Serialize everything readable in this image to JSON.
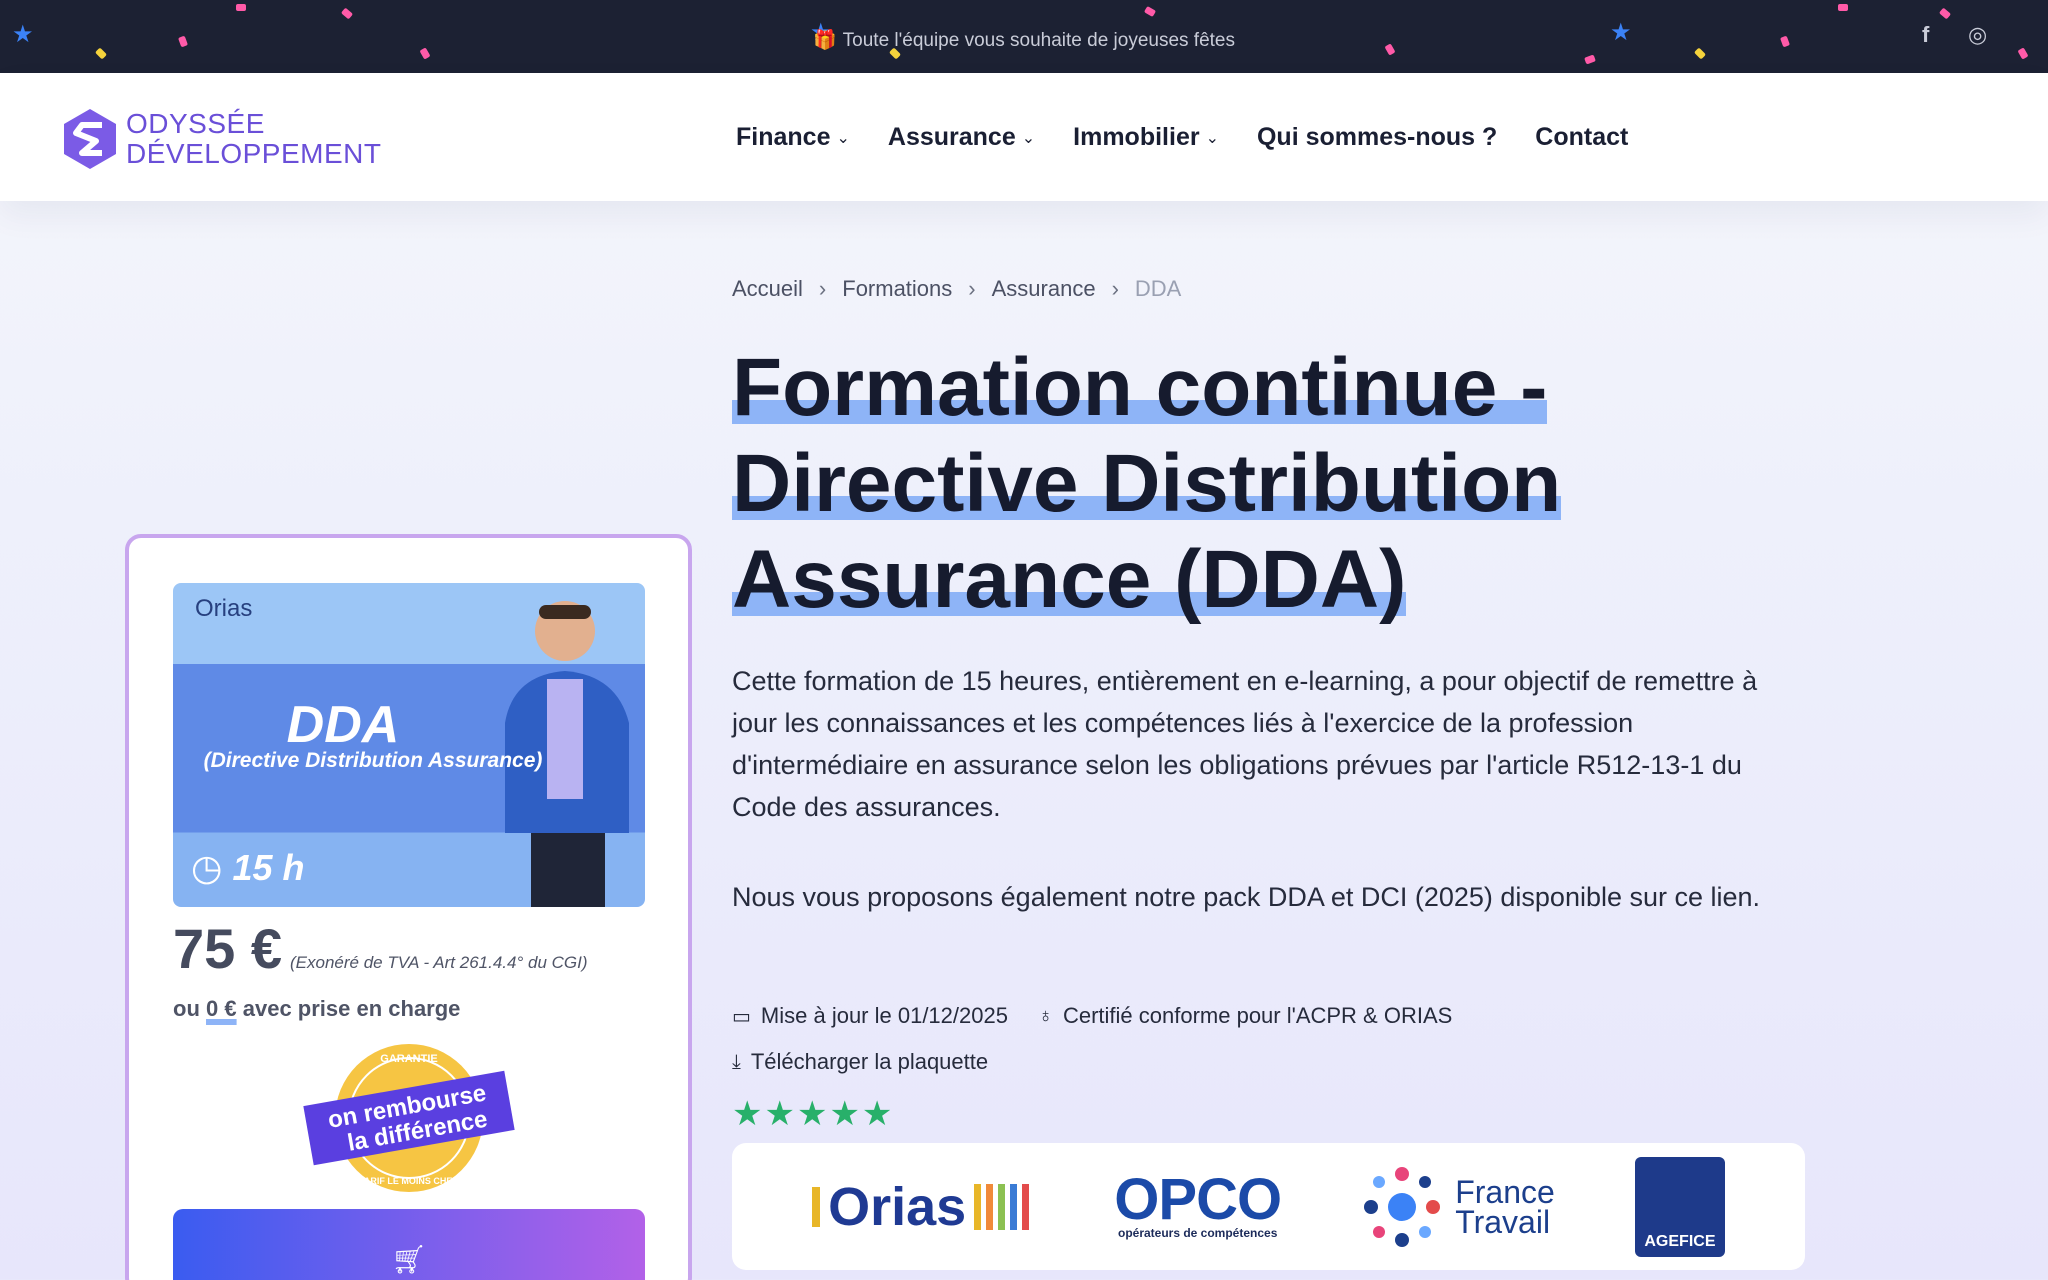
{
  "topbar": {
    "message": "Toute l'équipe vous souhaite de joyeuses fêtes",
    "social": {
      "facebook": "f",
      "instagram": "◎"
    }
  },
  "logo": {
    "line1": "ODYSSÉE",
    "line2": "DÉVELOPPEMENT"
  },
  "nav": {
    "items": [
      {
        "label": "Finance",
        "has_dropdown": true
      },
      {
        "label": "Assurance",
        "has_dropdown": true
      },
      {
        "label": "Immobilier",
        "has_dropdown": true
      },
      {
        "label": "Qui sommes-nous ?",
        "has_dropdown": false
      },
      {
        "label": "Contact",
        "has_dropdown": false
      }
    ]
  },
  "breadcrumb": [
    "Accueil",
    "Formations",
    "Assurance",
    "DDA"
  ],
  "title": {
    "line1": "Formation continue -",
    "line2": "Directive Distribution",
    "line3": "Assurance (DDA)"
  },
  "description": {
    "p1": "Cette formation de 15 heures, entièrement en e-learning, a pour objectif de remettre à jour les connaissances et les compétences liés à l'exercice de la profession d'intermédiaire en assurance selon les obligations prévues par l'article R512-13-1 du Code des assurances.",
    "p2": "Nous vous proposons également notre pack DDA et DCI (2025) disponible sur ce lien."
  },
  "meta": {
    "updated": "Mise à jour le 01/12/2025",
    "certified": "Certifié conforme pour l'ACPR & ORIAS",
    "download": "Télécharger la plaquette",
    "rating_stars": 5
  },
  "partners": {
    "orias": "Orias",
    "opco_big": "OPCO",
    "opco_small": "opérateurs de compétences",
    "ft_line1": "France",
    "ft_line2": "Travail",
    "agefice": "AGEFICE"
  },
  "card": {
    "banner_orias": "Orias",
    "banner_title": "DDA",
    "banner_subtitle": "(Directive Distribution Assurance)",
    "banner_hours": "15 h",
    "price": "75 €",
    "vat_note": "(Exonéré de TVA - Art 261.4.4° du CGI)",
    "alt_prefix": "ou",
    "alt_amount": "0 €",
    "alt_suffix": "avec prise en charge",
    "badge_top": "GARANTIE",
    "badge_line1": "on rembourse",
    "badge_line2": "la différence",
    "badge_bottom": "TARIF LE MOINS CHER"
  },
  "colors": {
    "topbar_bg": "#1c2133",
    "brand": "#6a4fd8",
    "highlight": "#8eb4f7",
    "card_border": "#c8a6ee",
    "stars": "#28b06a"
  }
}
